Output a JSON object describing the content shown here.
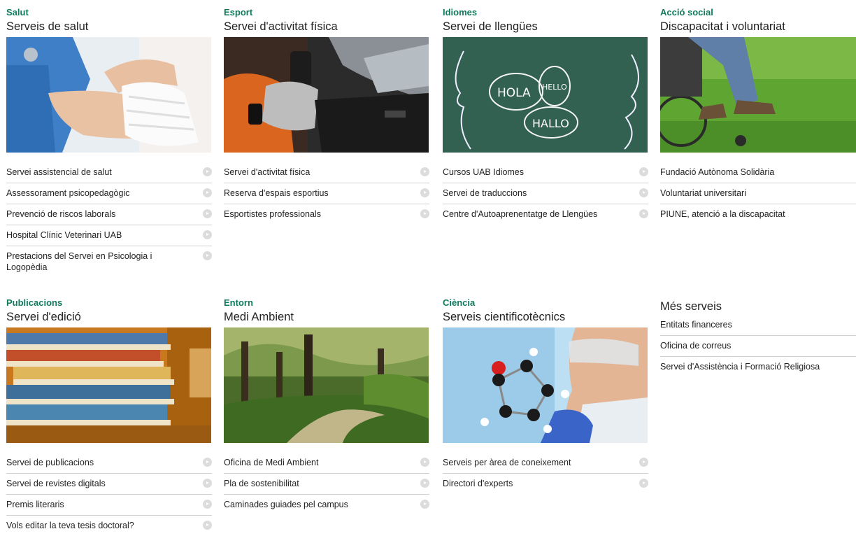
{
  "cards": [
    {
      "category": "Salut",
      "title": "Serveis de salut",
      "image": "medical-bandage-image",
      "links": [
        "Servei assistencial de salut",
        "Assessorament psicopedagògic",
        "Prevenció de riscos laborals",
        "Hospital Clínic Veterinari UAB",
        "Prestacions del Servei en Psicologia i Logopèdia"
      ]
    },
    {
      "category": "Esport",
      "title": "Servei d'activitat física",
      "image": "gym-equipment-image",
      "links": [
        "Servei d'activitat física",
        "Reserva d'espais esportius",
        "Esportistes professionals"
      ]
    },
    {
      "category": "Idiomes",
      "title": "Servei de llengües",
      "image": "chalkboard-languages-image",
      "chalk_words": [
        "HOLA",
        "HELLO",
        "HALLO"
      ],
      "links": [
        "Cursos UAB Idiomes",
        "Servei de traduccions",
        "Centre d'Autoaprenentatge de Llengües"
      ]
    },
    {
      "category": "Acció social",
      "title": "Discapacitat i voluntariat",
      "image": "wheelchair-image",
      "links": [
        "Fundació Autònoma Solidària",
        "Voluntariat universitari",
        "PIUNE, atenció a la discapacitat"
      ]
    },
    {
      "category": "Publicacions",
      "title": "Servei d'edició",
      "image": "books-stack-image",
      "links": [
        "Servei de publicacions",
        "Servei de revistes digitals",
        "Premis literaris",
        "Vols editar la teva tesis doctoral?"
      ]
    },
    {
      "category": "Entorn",
      "title": "Medi Ambient",
      "image": "forest-path-image",
      "links": [
        "Oficina de Medi Ambient",
        "Pla de sostenibilitat",
        "Caminades guiades pel campus"
      ]
    },
    {
      "category": "Ciència",
      "title": "Serveis cientificotècnics",
      "image": "scientist-molecule-image",
      "links": [
        "Serveis per àrea de coneixement",
        "Directori d'experts"
      ]
    }
  ],
  "more": {
    "title": "Més serveis",
    "links": [
      "Entitats financeres",
      "Oficina de correus",
      "Servei d'Assistència i Formació Religiosa"
    ]
  },
  "colors": {
    "category": "#0f7a5c",
    "divider": "#d0d0d0",
    "arrow": "#dcdcdc"
  }
}
